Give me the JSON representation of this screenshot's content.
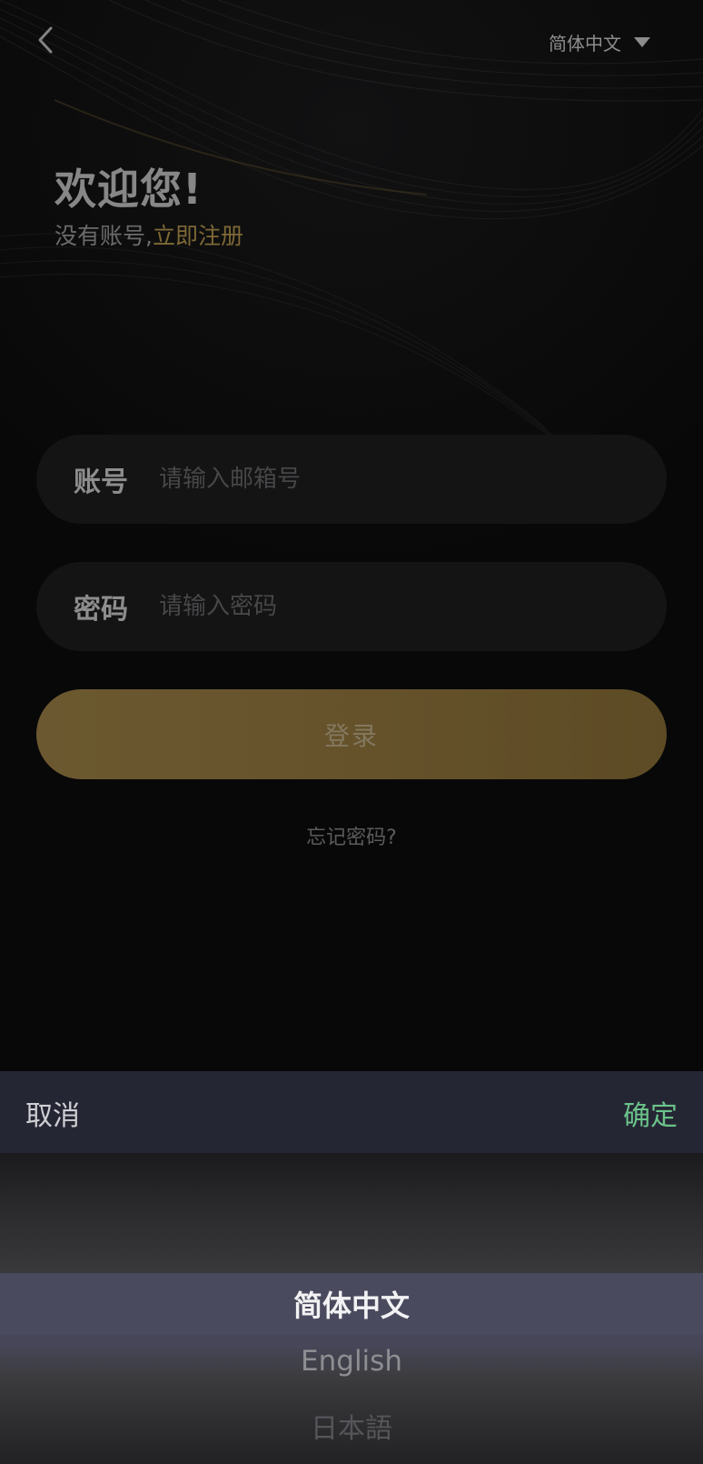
{
  "topbar": {
    "back_icon": "chevron-left-icon",
    "language_label": "简体中文",
    "dropdown_icon": "triangle-down-icon"
  },
  "welcome": {
    "title": "欢迎您!",
    "no_account": "没有账号,",
    "register_link": "立即注册"
  },
  "form": {
    "account_label": "账号",
    "account_placeholder": "请输入邮箱号",
    "account_value": "",
    "password_label": "密码",
    "password_placeholder": "请输入密码",
    "password_value": "",
    "login_label": "登录",
    "forgot_label": "忘记密码?"
  },
  "language_sheet": {
    "cancel_label": "取消",
    "confirm_label": "确定",
    "options": [
      "简体中文",
      "English",
      "日本語"
    ],
    "selected": "简体中文"
  },
  "colors": {
    "accent_gold": "#c2a052",
    "confirm_green": "#6bc38a",
    "background": "#0d0d0e"
  }
}
